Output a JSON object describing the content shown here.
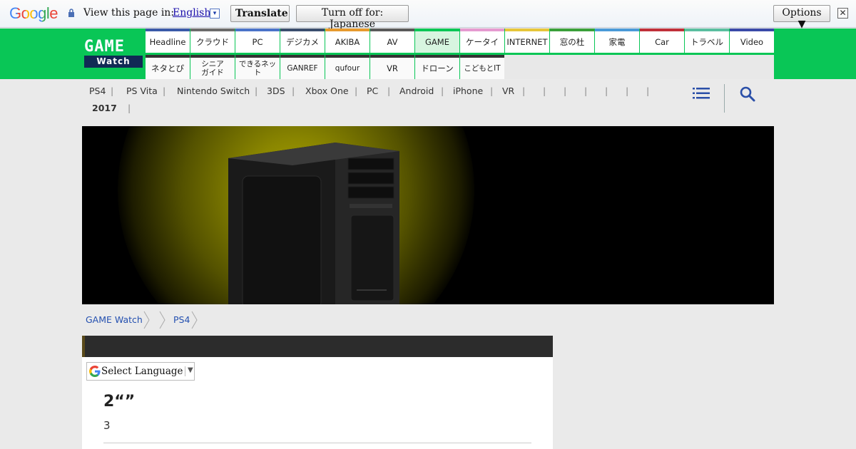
{
  "translate_bar": {
    "logo_text": "Google",
    "view_text": "View this page in:",
    "language": "English",
    "dropdown_glyph": "▾",
    "translate_label": "Translate",
    "turn_off_label": "Turn off for: Japanese",
    "options_label": "Options ▼",
    "close_glyph": "✕"
  },
  "logo": {
    "top": "GAME",
    "bottom": "Watch"
  },
  "nav": {
    "row1": [
      {
        "label": "Headline",
        "color": "#3a5aa8"
      },
      {
        "label": "クラウド",
        "color": "#6b6b6b"
      },
      {
        "label": "PC",
        "color": "#4a73c9"
      },
      {
        "label": "デジカメ",
        "color": "#3b4e6e"
      },
      {
        "label": "AKIBA",
        "color": "#e69a2e"
      },
      {
        "label": "AV",
        "color": "#5a5a5a"
      },
      {
        "label": "GAME",
        "color": "#09c656"
      },
      {
        "label": "ケータイ",
        "color": "#e59ad0"
      },
      {
        "label": "INTERNET",
        "color": "#e6c63a"
      },
      {
        "label": "窓の杜",
        "color": "#3aa03a"
      },
      {
        "label": "家電",
        "color": "#4a9ad8"
      },
      {
        "label": "Car",
        "color": "#c0303a"
      },
      {
        "label": "トラベル",
        "color": "#5abea0"
      },
      {
        "label": "Video",
        "color": "#3a4aa8"
      }
    ],
    "row2": [
      {
        "label": "ネタとぴ",
        "color": "#333333"
      },
      {
        "label": "シニア\nガイド",
        "color": "#333333"
      },
      {
        "label": "できるネット",
        "color": "#333333"
      },
      {
        "label": "GANREF",
        "color": "#333333"
      },
      {
        "label": "qufour",
        "color": "#333333"
      },
      {
        "label": "VR",
        "color": "#333333"
      },
      {
        "label": "ドローン",
        "color": "#333333"
      },
      {
        "label": "こどもとIT",
        "color": "#333333"
      }
    ]
  },
  "subnav": {
    "items": [
      "PS4",
      "PS Vita",
      "Nintendo Switch",
      "3DS",
      "Xbox One",
      "PC",
      "Android",
      "iPhone",
      "VR"
    ],
    "separator": "|",
    "year": "2017"
  },
  "breadcrumb": [
    "GAME Watch",
    "",
    "PS4"
  ],
  "select_language": {
    "label": "Select Language",
    "arrow": "▼"
  },
  "article": {
    "title": "2“”",
    "subtitle": "3"
  },
  "colors": {
    "green": "#09c656",
    "link": "#2450b0"
  }
}
